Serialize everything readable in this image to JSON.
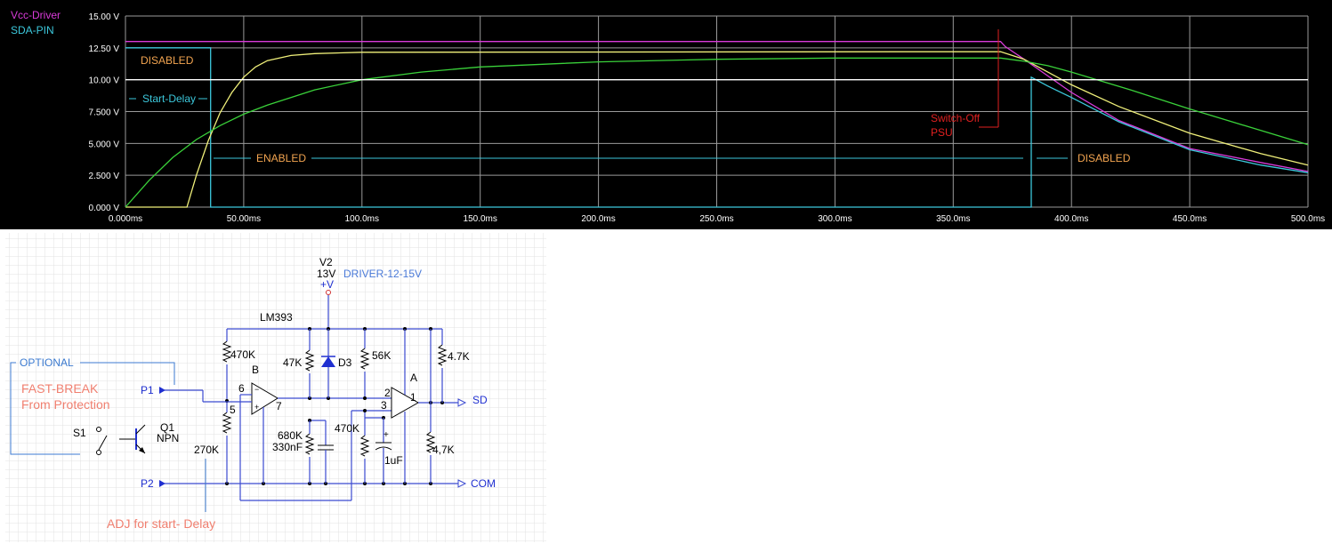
{
  "chart_data": {
    "type": "line",
    "legend": [
      {
        "name": "Vcc-Driver",
        "color": "#d93bd9"
      },
      {
        "name": "SDA-PIN",
        "color": "#3cc8dc"
      }
    ],
    "xlim": [
      0,
      500
    ],
    "ylim": [
      0,
      15
    ],
    "x_ticks": [
      "0.000ms",
      "50.00ms",
      "100.0ms",
      "150.0ms",
      "200.0ms",
      "250.0ms",
      "300.0ms",
      "350.0ms",
      "400.0ms",
      "450.0ms",
      "500.0ms"
    ],
    "y_ticks": [
      "0.000 V",
      "2.500 V",
      "5.000 V",
      "7.500 V",
      "10.00 V",
      "12.50 V",
      "15.00 V"
    ],
    "grid": true,
    "series": [
      {
        "color": "#d93bd9",
        "x": [
          0,
          370,
          372,
          380,
          390,
          400,
          420,
          450,
          480,
          500
        ],
        "y": [
          13,
          13,
          12.6,
          11.6,
          10.3,
          9.0,
          6.8,
          4.6,
          3.5,
          2.8
        ]
      },
      {
        "color": "#3cc8dc",
        "x": [
          0,
          36,
          36,
          383,
          383,
          390,
          400,
          420,
          450,
          480,
          500
        ],
        "y": [
          12.5,
          12.5,
          0,
          0,
          10.2,
          9.5,
          8.6,
          6.7,
          4.5,
          3.3,
          2.7
        ]
      },
      {
        "color": "#f0f07a",
        "x": [
          0,
          26,
          30,
          35,
          40,
          45,
          50,
          55,
          60,
          70,
          80,
          100,
          370,
          380,
          390,
          400,
          420,
          450,
          480,
          500
        ],
        "y": [
          0,
          0,
          2.5,
          5.2,
          7.4,
          9.0,
          10.2,
          11.0,
          11.5,
          11.9,
          12.05,
          12.15,
          12.2,
          11.6,
          10.6,
          9.6,
          7.9,
          5.8,
          4.2,
          3.3
        ]
      },
      {
        "color": "#3ad23a",
        "x": [
          0,
          10,
          20,
          30,
          40,
          50,
          60,
          80,
          100,
          125,
          150,
          200,
          250,
          300,
          370,
          380,
          390,
          400,
          425,
          450,
          500
        ],
        "y": [
          0,
          2.1,
          3.9,
          5.3,
          6.4,
          7.3,
          8.0,
          9.2,
          10.0,
          10.6,
          11.0,
          11.4,
          11.6,
          11.7,
          11.7,
          11.45,
          11.1,
          10.6,
          9.2,
          7.7,
          4.9
        ]
      },
      {
        "color": "#ffffff",
        "x": [
          0,
          500
        ],
        "y": [
          10,
          10
        ]
      }
    ],
    "annotations": [
      {
        "text": "DISABLED",
        "color": "#f2a450"
      },
      {
        "text": "Start-Delay",
        "color": "#3cc8dc"
      },
      {
        "text": "ENABLED",
        "color": "#f2a450"
      },
      {
        "text": "DISABLED",
        "color": "#f2a450"
      },
      {
        "text": "Switch-Off",
        "color": "#e02020"
      },
      {
        "text": "PSU",
        "color": "#e02020"
      }
    ]
  },
  "schematic": {
    "supply": {
      "name": "V2",
      "voltage": "13V",
      "terminal": "+V",
      "label": "DRIVER-12-15V"
    },
    "ic": "LM393",
    "comparators": {
      "b": "B",
      "a": "A",
      "b_pins": [
        "6",
        "5",
        "7"
      ],
      "a_pins": [
        "2",
        "3",
        "1"
      ]
    },
    "components": {
      "r1": "470K",
      "r2": "47K",
      "diode": "D3",
      "r3": "56K",
      "r4": "4.7K",
      "r5": "270K",
      "r6": "680K",
      "cap1": "330nF",
      "r7": "470K",
      "cap2": "1uF",
      "r8": "4,7K",
      "transistor": "Q1",
      "transistor_type": "NPN",
      "switch": "S1"
    },
    "ports": {
      "p1": "P1",
      "p2": "P2",
      "sd": "SD",
      "com": "COM"
    },
    "notes": {
      "optional": "OPTIONAL",
      "fast_break_1": "FAST-BREAK",
      "fast_break_2": "From Protection",
      "adj": "ADJ for start- Delay"
    },
    "colors": {
      "wire": "#3b4ad0",
      "note": "#f07f6f",
      "optional": "#3b7ad0"
    }
  }
}
